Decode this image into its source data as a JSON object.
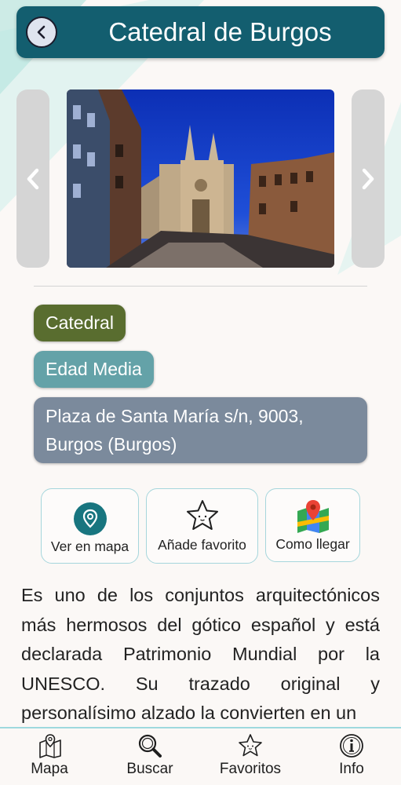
{
  "header": {
    "title": "Catedral de Burgos",
    "back_icon": "back-circle-icon"
  },
  "gallery": {
    "prev_icon": "chevron-left-icon",
    "next_icon": "chevron-right-icon",
    "image_subject": "cathedral-photo"
  },
  "tags": {
    "category": "Catedral",
    "era": "Edad Media",
    "address": "Plaza de Santa María s/n, 9003, Burgos (Burgos)"
  },
  "actions": [
    {
      "label": "Ver en mapa",
      "icon": "map-pin-icon"
    },
    {
      "label": "Añade favorito",
      "icon": "star-icon"
    },
    {
      "label": "Como llegar",
      "icon": "google-maps-icon"
    }
  ],
  "description": "Es uno de los conjuntos arquitectónicos más hermosos del gótico español  y está declarada Patrimonio Mundial por la UNESCO. Su trazado original y personalísimo alzado la convierten en un",
  "nav": [
    {
      "label": "Mapa",
      "icon": "map-icon"
    },
    {
      "label": "Buscar",
      "icon": "magnifier-icon"
    },
    {
      "label": "Favoritos",
      "icon": "star-icon"
    },
    {
      "label": "Info",
      "icon": "info-icon"
    }
  ],
  "colors": {
    "header": "#135e6f",
    "tag_category": "#596d2f",
    "tag_era": "#64a2a8",
    "tag_address": "#7b8a9c",
    "accent": "#a6d6dc"
  }
}
